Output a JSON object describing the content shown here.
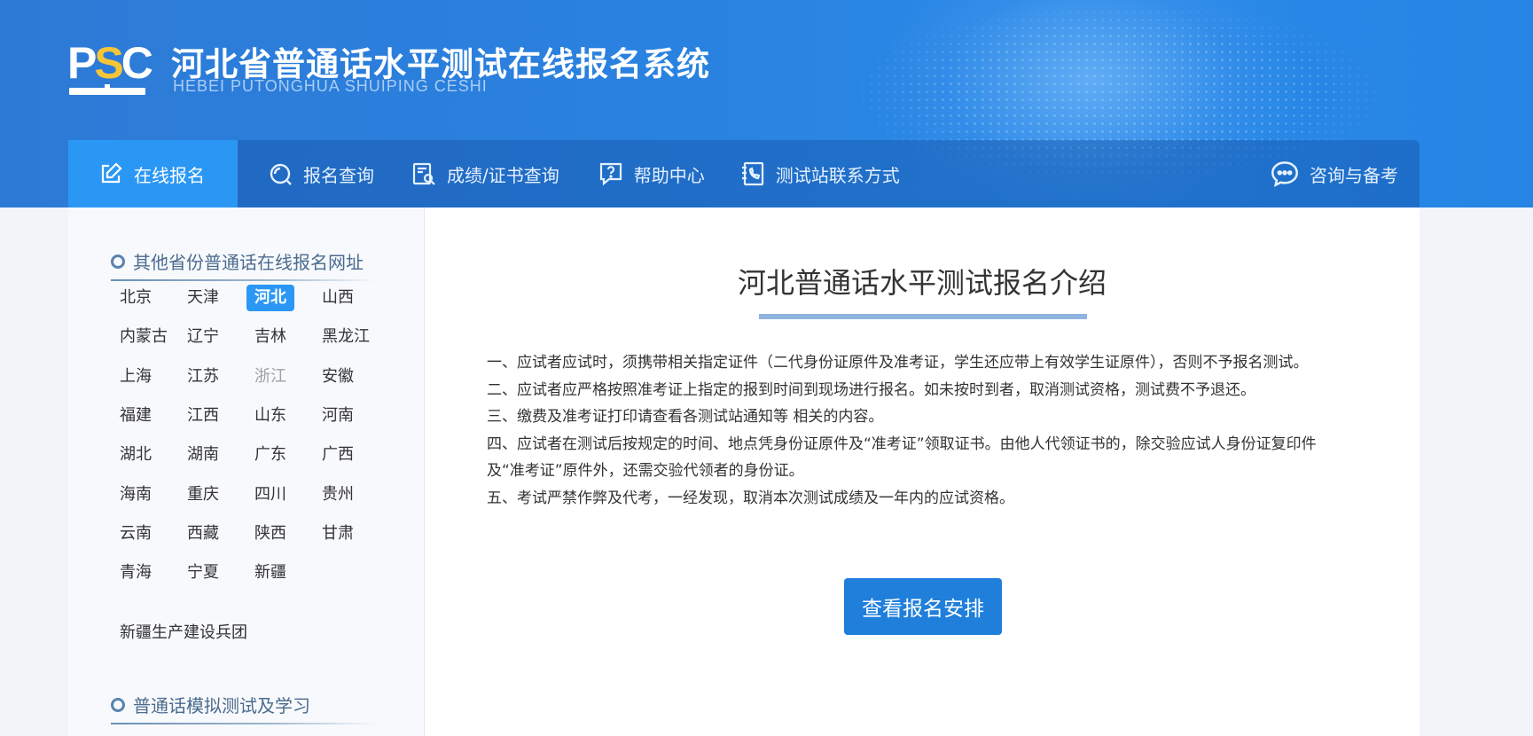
{
  "header": {
    "logo": "PSC",
    "title": "河北省普通话水平测试在线报名系统",
    "subtitle": "HEBEI PUTONGHUA SHUIPING CESHI"
  },
  "nav": {
    "items": [
      {
        "label": "在线报名",
        "icon": "edit-icon"
      },
      {
        "label": "报名查询",
        "icon": "search-icon"
      },
      {
        "label": "成绩/证书查询",
        "icon": "certificate-search-icon"
      },
      {
        "label": "帮助中心",
        "icon": "help-icon"
      },
      {
        "label": "测试站联系方式",
        "icon": "phone-book-icon"
      }
    ],
    "right": {
      "label": "咨询与备考",
      "icon": "chat-icon"
    }
  },
  "sidebar": {
    "section1_title": "其他省份普通话在线报名网址",
    "provinces": [
      "北京",
      "天津",
      "河北",
      "山西",
      "内蒙古",
      "辽宁",
      "吉林",
      "黑龙江",
      "上海",
      "江苏",
      "浙江",
      "安徽",
      "福建",
      "江西",
      "山东",
      "河南",
      "湖北",
      "湖南",
      "广东",
      "广西",
      "海南",
      "重庆",
      "四川",
      "贵州",
      "云南",
      "西藏",
      "陕西",
      "甘肃",
      "青海",
      "宁夏",
      "新疆"
    ],
    "active_province": "河北",
    "muted_province": "浙江",
    "extra": "新疆生产建设兵团",
    "section2_title": "普通话模拟测试及学习"
  },
  "main": {
    "title": "河北普通话水平测试报名介绍",
    "rules": [
      "一、应试者应试时，须携带相关指定证件（二代身份证原件及准考证，学生还应带上有效学生证原件），否则不予报名测试。",
      "二、应试者应严格按照准考证上指定的报到时间到现场进行报名。如未按时到者，取消测试资格，测试费不予退还。",
      "三、缴费及准考证打印请查看各测试站通知等 相关的内容。",
      "四、应试者在测试后按规定的时间、地点凭身份证原件及“准考证”领取证书。由他人代领证书的，除交验应试人身份证复印件",
      "及“准考证”原件外，还需交验代领者的身份证。",
      "五、考试严禁作弊及代考，一经发现，取消本次测试成绩及一年内的应试资格。"
    ],
    "cta_label": "查看报名安排"
  },
  "colors": {
    "accent": "#2b97f5",
    "header": "#2a82e0",
    "button": "#1f7fdb"
  }
}
